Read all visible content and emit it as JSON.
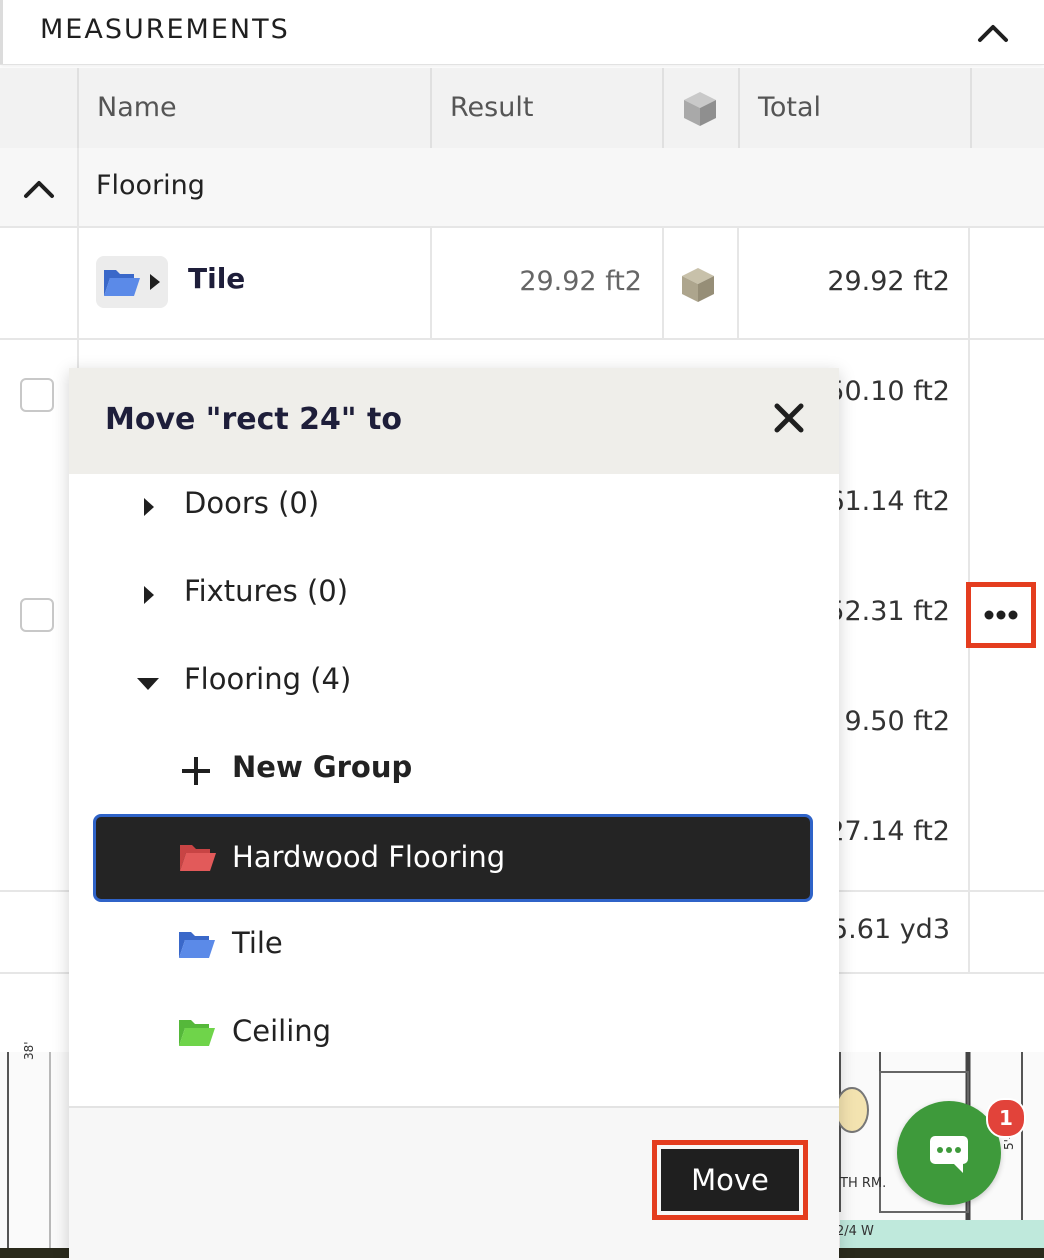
{
  "panel": {
    "title": "MEASUREMENTS"
  },
  "table": {
    "columns": {
      "name": "Name",
      "result": "Result",
      "total": "Total"
    },
    "group": {
      "label": "Flooring"
    },
    "tile_row": {
      "name": "Tile",
      "result": "29.92 ft2",
      "total": "29.92 ft2"
    },
    "partial_totals": [
      "50.10 ft2",
      "61.14 ft2",
      "52.31 ft2",
      "9.50 ft2",
      "27.14 ft2",
      "5.61 yd3"
    ]
  },
  "modal": {
    "title": "Move \"rect 24\" to",
    "tree": [
      {
        "label": "Doors (0)"
      },
      {
        "label": "Fixtures (0)"
      },
      {
        "label": "Flooring (4)"
      }
    ],
    "new_group_label": "New Group",
    "folders": [
      {
        "label": "Hardwood Flooring",
        "color": "#e25a5a",
        "selected": true
      },
      {
        "label": "Tile",
        "color": "#4b7de0",
        "selected": false
      },
      {
        "label": "Ceiling",
        "color": "#6fd44a",
        "selected": false
      }
    ],
    "move_label": "Move"
  },
  "plan_labels": {
    "room": "TH RM.",
    "dim": "2/4 W",
    "side": "38'",
    "right": "5'-0"
  },
  "chat": {
    "badge": "1"
  },
  "colors": {
    "accent_red": "#e43d1f",
    "chat_green": "#3e9a3b",
    "selection_blue": "#2f63c8"
  }
}
